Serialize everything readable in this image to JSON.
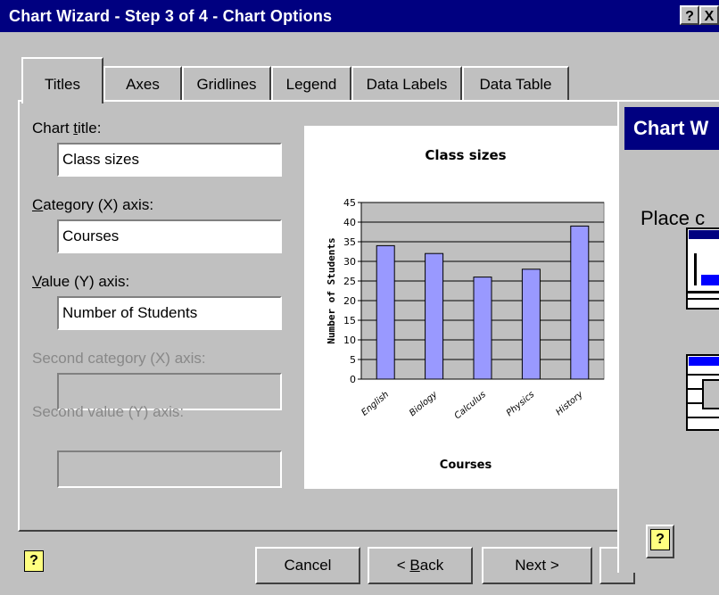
{
  "title_bar": {
    "title": "Chart Wizard - Step 3 of 4 - Chart Options",
    "help_label": "?",
    "close_label": "X"
  },
  "tabs": [
    {
      "label": "Titles",
      "active": true
    },
    {
      "label": "Axes",
      "active": false
    },
    {
      "label": "Gridlines",
      "active": false
    },
    {
      "label": "Legend",
      "active": false
    },
    {
      "label": "Data Labels",
      "active": false
    },
    {
      "label": "Data Table",
      "active": false
    }
  ],
  "fields": {
    "chart_title": {
      "label_pre": "Chart ",
      "label_u": "t",
      "label_post": "itle:",
      "value": "Class sizes"
    },
    "category_x": {
      "label_pre": "",
      "label_u": "C",
      "label_post": "ategory (X) axis:",
      "value": "Courses"
    },
    "value_y": {
      "label_pre": "",
      "label_u": "V",
      "label_post": "alue (Y) axis:",
      "value": "Number of Students"
    },
    "second_category_x": {
      "label": "Second category (X) axis:",
      "value": ""
    },
    "second_value_y": {
      "label": "Second value (Y) axis:",
      "value": ""
    }
  },
  "chart_data": {
    "type": "bar",
    "title": "Class sizes",
    "xlabel": "Courses",
    "ylabel": "Number of Students",
    "categories": [
      "English",
      "Biology",
      "Calculus",
      "Physics",
      "History"
    ],
    "values": [
      34,
      32,
      26,
      28,
      39
    ],
    "ylim": [
      0,
      45
    ],
    "yticks": [
      "0",
      "5",
      "10",
      "15",
      "20",
      "25",
      "30",
      "35",
      "40",
      "45"
    ],
    "gridlines": true,
    "bar_color": "#9999ff",
    "plot_bg": "#c0c0c0"
  },
  "buttons": {
    "cancel": "Cancel",
    "back_pre": "< ",
    "back_u": "B",
    "back_post": "ack",
    "next": "Next >",
    "help_icon": "help-icon"
  },
  "second_window": {
    "title": "Chart W",
    "text": "Place c",
    "help_label": "?"
  },
  "colors": {
    "titlebar": "#000080",
    "dialog": "#c0c0c0",
    "disabled_text": "#888888"
  }
}
